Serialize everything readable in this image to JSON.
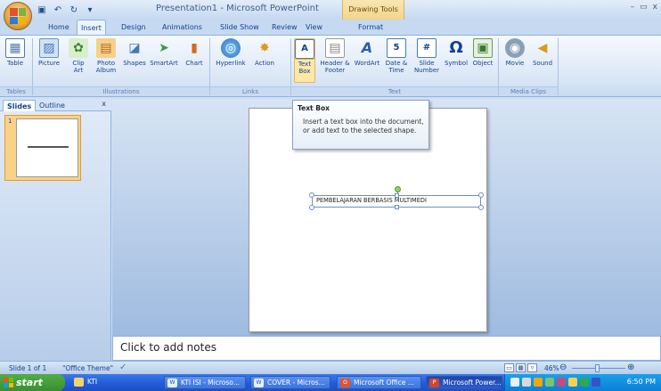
{
  "title_bar": {
    "document_title": "Presentation1 - Microsoft PowerPoint",
    "context_tab": "Drawing Tools",
    "minimize": "–",
    "restore": "▭",
    "close": "x"
  },
  "tabs": [
    "Home",
    "Insert",
    "Design",
    "Animations",
    "Slide Show",
    "Review",
    "View",
    "Format"
  ],
  "active_tab": "Insert",
  "ribbon": {
    "groups": {
      "tables": "Tables",
      "illustrations": "Illustrations",
      "links": "Links",
      "text": "Text",
      "media": "Media Clips"
    },
    "buttons": {
      "table": "Table",
      "picture": "Picture",
      "clip_art": "Clip Art",
      "photo_album": "Photo Album",
      "shapes": "Shapes",
      "smartart": "SmartArt",
      "chart": "Chart",
      "hyperlink": "Hyperlink",
      "action": "Action",
      "text_box": "Text Box",
      "header_footer": "Header & Footer",
      "wordart": "WordArt",
      "date_time": "Date & Time",
      "slide_number": "Slide Number",
      "symbol": "Symbol",
      "object": "Object",
      "movie": "Movie",
      "sound": "Sound"
    }
  },
  "tooltip": {
    "title": "Text Box",
    "body": "Insert a text box into the document, or add text to the selected shape."
  },
  "left_pane": {
    "tab_slides": "Slides",
    "tab_outline": "Outline",
    "close": "x",
    "slide_number": "1"
  },
  "slide": {
    "textbox_text": "PEMBELAJARAN BERBASIS MULTIMEDI"
  },
  "notes": {
    "placeholder": "Click to add notes"
  },
  "status_bar": {
    "slide_info": "Slide 1 of 1",
    "theme": "\"Office Theme\"",
    "zoom": "46%"
  },
  "taskbar": {
    "start": "start",
    "items": [
      "KTI",
      "KTI ISI - Microso...",
      "COVER - Micros...",
      "Microsoft Office ...",
      "Microsoft Power..."
    ],
    "active_index": 4,
    "clock": "6:50 PM"
  },
  "colors": {
    "ribbon_bg": "#dbe7f6",
    "accent_blue": "#15428b",
    "context_tab": "#f3d48a",
    "taskbar": "#245edb",
    "start_green": "#3a8f31"
  }
}
